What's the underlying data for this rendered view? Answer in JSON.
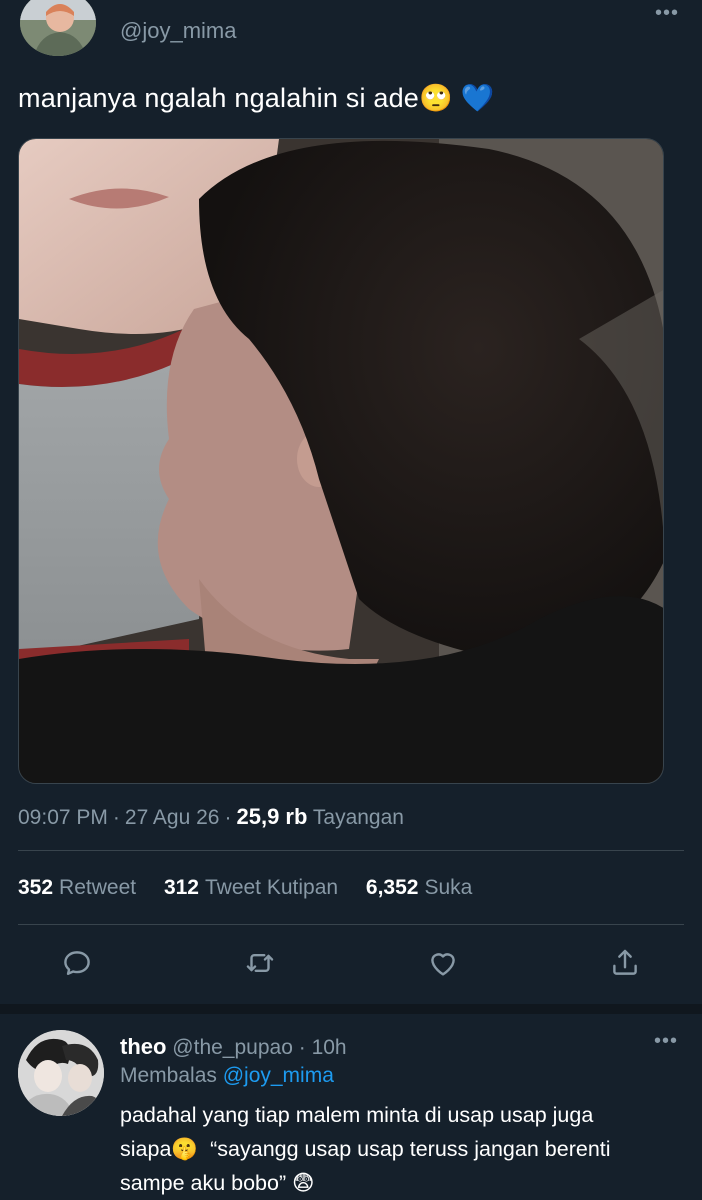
{
  "tweet": {
    "handle": "@joy_mima",
    "more": "•••",
    "text": "manjanya ngalah ngalahin si ade🙄 💙",
    "time": "09:07 PM",
    "date": "27 Agu 26",
    "meta_sep": "·",
    "views": "25,9 rb",
    "views_label": "Tayangan"
  },
  "stats": {
    "retweets": "352",
    "retweets_label": "Retweet",
    "quotes": "312",
    "quotes_label": "Tweet Kutipan",
    "likes": "6,352",
    "likes_label": "Suka"
  },
  "actions": [
    {
      "icon": "reply-icon"
    },
    {
      "icon": "retweet-icon"
    },
    {
      "icon": "like-icon"
    },
    {
      "icon": "share-icon"
    }
  ],
  "reply": {
    "name": "theo",
    "handle": "@the_pupao",
    "sep": "·",
    "time": "10h",
    "more": "•••",
    "replying_label": "Membalas",
    "replying_to": "@joy_mima",
    "text": "padahal yang tiap malem minta di usap usap juga\nsiapa🤫  “sayangg usap usap teruss jangan berenti\nsampe aku bobo” 😨"
  },
  "colors": {
    "background": "#15202b",
    "secondary_text": "#8899a6",
    "link": "#1d9bf0",
    "divider": "#38444d"
  }
}
